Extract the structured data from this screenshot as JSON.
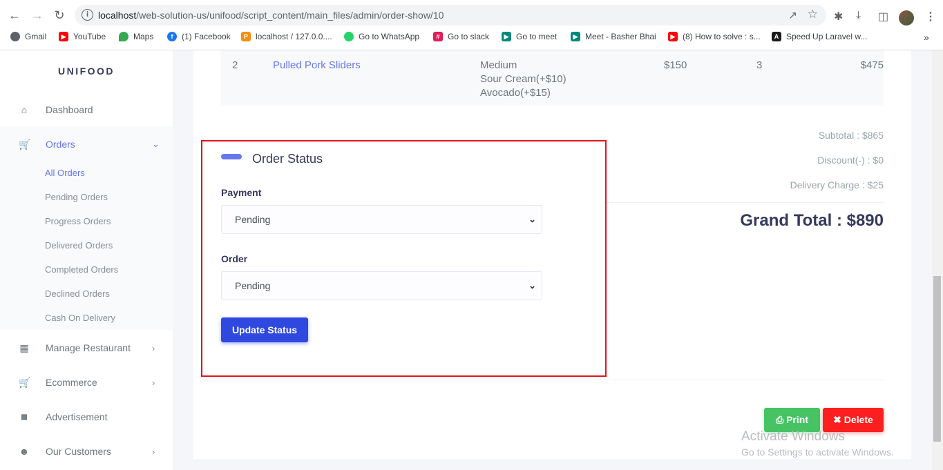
{
  "browser": {
    "url_host": "localhost",
    "url_path": "/web-solution-us/unifood/script_content/main_files/admin/order-show/10",
    "bookmarks": [
      {
        "label": "Gmail",
        "icon": "gmail-icon"
      },
      {
        "label": "YouTube",
        "icon": "youtube-icon"
      },
      {
        "label": "Maps",
        "icon": "maps-icon"
      },
      {
        "label": "(1) Facebook",
        "icon": "facebook-icon"
      },
      {
        "label": "localhost / 127.0.0....",
        "icon": "phpmyadmin-icon"
      },
      {
        "label": "Go to WhatsApp",
        "icon": "whatsapp-icon"
      },
      {
        "label": "Go to slack",
        "icon": "slack-icon"
      },
      {
        "label": "Go to meet",
        "icon": "meet-icon"
      },
      {
        "label": "Meet - Basher Bhai",
        "icon": "meet-icon"
      },
      {
        "label": "(8) How to solve : s...",
        "icon": "youtube-icon"
      },
      {
        "label": "Speed Up Laravel w...",
        "icon": "laravel-icon"
      }
    ]
  },
  "sidebar": {
    "brand": "UNIFOOD",
    "dashboard": "Dashboard",
    "orders": "Orders",
    "orders_sub": [
      "All Orders",
      "Pending Orders",
      "Progress Orders",
      "Delivered Orders",
      "Completed Orders",
      "Declined Orders",
      "Cash On Delivery"
    ],
    "manage_restaurant": "Manage Restaurant",
    "ecommerce": "Ecommerce",
    "advertisement": "Advertisement",
    "our_customers": "Our Customers"
  },
  "order_row": {
    "index": "2",
    "product": "Pulled Pork Sliders",
    "size": "Medium",
    "extra1": "Sour Cream(+$10)",
    "extra2": "Avocado(+$15)",
    "price": "$150",
    "qty": "3",
    "total": "$475"
  },
  "totals": {
    "subtotal": "Subtotal : $865",
    "discount": "Discount(-) : $0",
    "delivery": "Delivery Charge : $25",
    "grand": "Grand Total : $890"
  },
  "order_status": {
    "title": "Order Status",
    "payment_label": "Payment",
    "payment_value": "Pending",
    "order_label": "Order",
    "order_value": "Pending",
    "update_label": "Update Status"
  },
  "actions": {
    "print": "Print",
    "delete": "Delete"
  },
  "watermark": {
    "line1": "Activate Windows",
    "line2": "Go to Settings to activate Windows."
  },
  "colors": {
    "primary": "#6777ef",
    "success": "#47c363",
    "danger": "#fc1f1f",
    "highlight_border": "#e3121b"
  }
}
